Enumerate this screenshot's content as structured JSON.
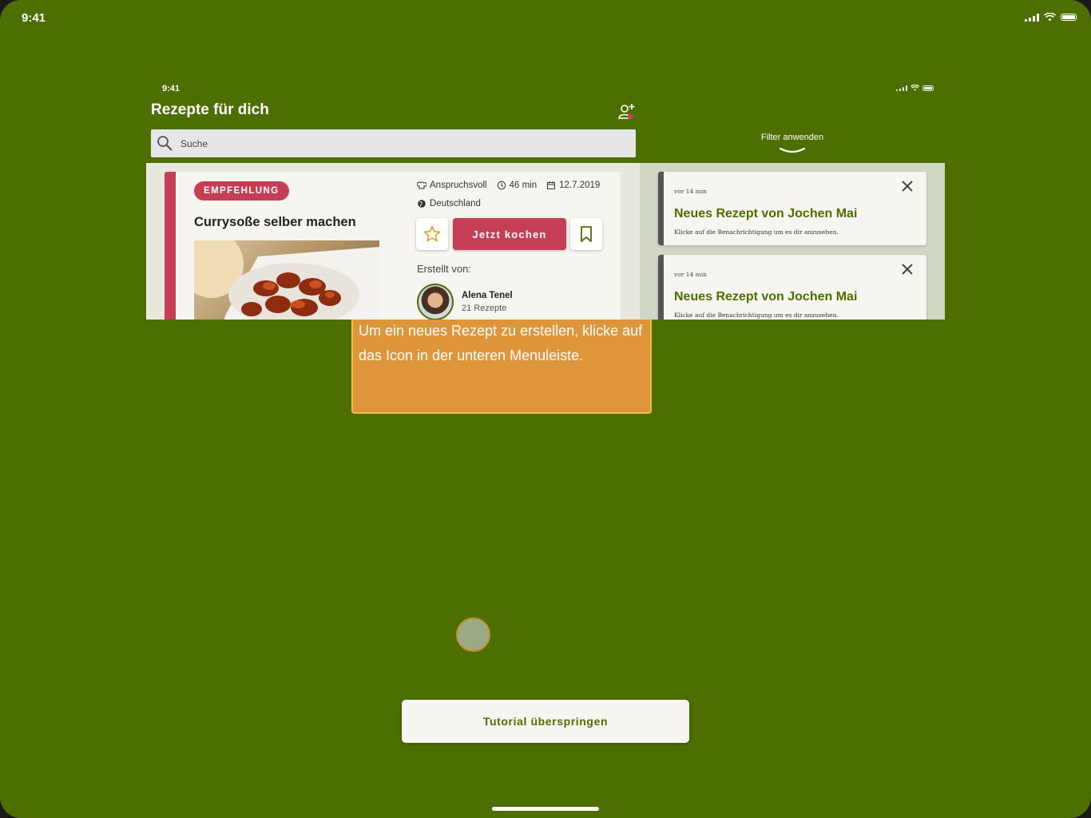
{
  "status_bar": {
    "time": "9:41"
  },
  "inner": {
    "status_time": "9:41",
    "title": "Rezepte für dich",
    "search": {
      "placeholder": "Suche"
    },
    "filter": {
      "label": "Filter anwenden"
    },
    "recipe_card": {
      "badge": "EMPFEHLUNG",
      "title": "Currysoße selber machen",
      "difficulty": "Anspruchsvoll",
      "duration": "46 min",
      "date": "12.7.2019",
      "country": "Deutschland",
      "cook_label": "Jetzt kochen",
      "created_by_label": "Erstellt von:",
      "author_name": "Alena Tenel",
      "author_recipes": "21 Rezepte"
    },
    "notifications": [
      {
        "time": "vor 14 min",
        "title": "Neues Rezept von Jochen Mai",
        "text": "Klicke auf die Benachrichtigung um es dir anzusehen."
      },
      {
        "time": "vor 14 min",
        "title": "Neues Rezept von Jochen Mai",
        "text": "Klicke auf die Benachrichtigung um es dir anzusehen."
      }
    ]
  },
  "tutorial": {
    "tooltip_text": "Um ein neues Rezept zu erstellen, klicke auf das Icon in der unteren Menuleiste.",
    "skip_label": "Tutorial überspringen"
  },
  "colors": {
    "background": "#4d6e00",
    "accent": "#c43f55",
    "tooltip": "#df963a"
  },
  "icons": [
    "add-user-icon",
    "search-icon",
    "chevron-down-icon",
    "chef-hat-icon",
    "clock-icon",
    "calendar-icon",
    "globe-icon",
    "star-icon",
    "bookmark-icon",
    "close-icon"
  ]
}
